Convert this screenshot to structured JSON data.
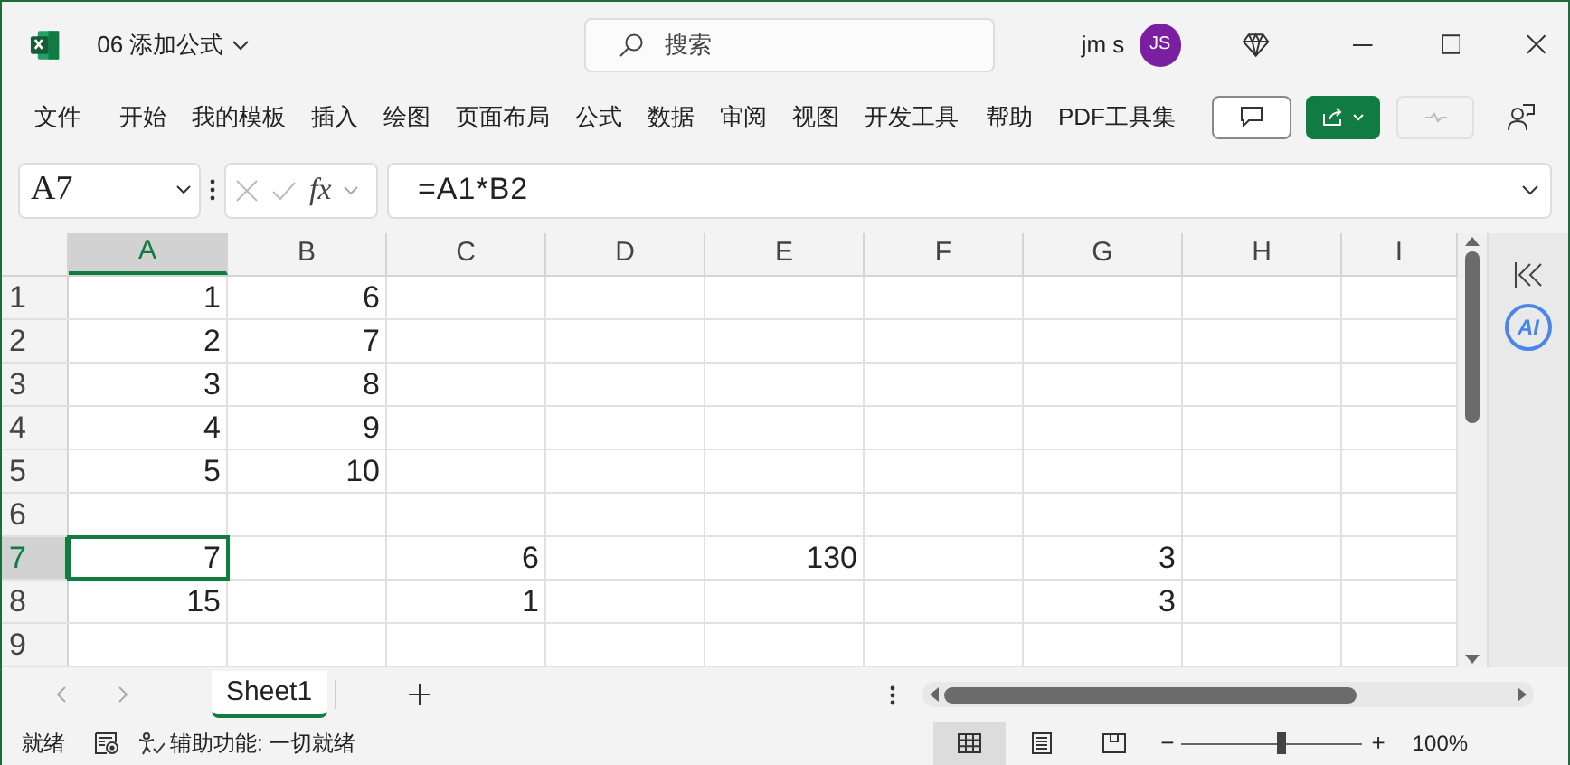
{
  "title_bar": {
    "file_name": "06 添加公式",
    "search_placeholder": "搜索",
    "user_name": "jm s",
    "avatar_initials": "JS"
  },
  "menu": [
    {
      "label": "文件"
    },
    {
      "label": "开始"
    },
    {
      "label": "我的模板"
    },
    {
      "label": "插入"
    },
    {
      "label": "绘图"
    },
    {
      "label": "页面布局"
    },
    {
      "label": "公式"
    },
    {
      "label": "数据"
    },
    {
      "label": "审阅"
    },
    {
      "label": "视图"
    },
    {
      "label": "开发工具"
    },
    {
      "label": "帮助"
    },
    {
      "label": "PDF工具集"
    }
  ],
  "formula_bar": {
    "name_box": "A7",
    "fx": "fx",
    "formula": "=A1*B2"
  },
  "columns": [
    {
      "label": "A",
      "selected": true
    },
    {
      "label": "B",
      "selected": false
    },
    {
      "label": "C",
      "selected": false
    },
    {
      "label": "D",
      "selected": false
    },
    {
      "label": "E",
      "selected": false
    },
    {
      "label": "F",
      "selected": false
    },
    {
      "label": "G",
      "selected": false
    },
    {
      "label": "H",
      "selected": false
    },
    {
      "label": "I",
      "selected": false
    }
  ],
  "rows": [
    {
      "label": "1",
      "selected": false,
      "cells": [
        {
          "kind": "value",
          "value": "1",
          "selected": false
        },
        {
          "kind": "value",
          "value": "6",
          "selected": false
        },
        {
          "kind": "empty"
        },
        {
          "kind": "empty"
        },
        {
          "kind": "empty"
        },
        {
          "kind": "empty"
        },
        {
          "kind": "empty"
        },
        {
          "kind": "empty"
        },
        {
          "kind": "empty"
        }
      ]
    },
    {
      "label": "2",
      "selected": false,
      "cells": [
        {
          "kind": "value",
          "value": "2",
          "selected": false
        },
        {
          "kind": "value",
          "value": "7",
          "selected": false
        },
        {
          "kind": "empty"
        },
        {
          "kind": "empty"
        },
        {
          "kind": "empty"
        },
        {
          "kind": "empty"
        },
        {
          "kind": "empty"
        },
        {
          "kind": "empty"
        },
        {
          "kind": "empty"
        }
      ]
    },
    {
      "label": "3",
      "selected": false,
      "cells": [
        {
          "kind": "value",
          "value": "3",
          "selected": false
        },
        {
          "kind": "value",
          "value": "8",
          "selected": false
        },
        {
          "kind": "empty"
        },
        {
          "kind": "empty"
        },
        {
          "kind": "empty"
        },
        {
          "kind": "empty"
        },
        {
          "kind": "empty"
        },
        {
          "kind": "empty"
        },
        {
          "kind": "empty"
        }
      ]
    },
    {
      "label": "4",
      "selected": false,
      "cells": [
        {
          "kind": "value",
          "value": "4",
          "selected": false
        },
        {
          "kind": "value",
          "value": "9",
          "selected": false
        },
        {
          "kind": "empty"
        },
        {
          "kind": "empty"
        },
        {
          "kind": "empty"
        },
        {
          "kind": "empty"
        },
        {
          "kind": "empty"
        },
        {
          "kind": "empty"
        },
        {
          "kind": "empty"
        }
      ]
    },
    {
      "label": "5",
      "selected": false,
      "cells": [
        {
          "kind": "value",
          "value": "5",
          "selected": false
        },
        {
          "kind": "value",
          "value": "10",
          "selected": false
        },
        {
          "kind": "empty"
        },
        {
          "kind": "empty"
        },
        {
          "kind": "empty"
        },
        {
          "kind": "empty"
        },
        {
          "kind": "empty"
        },
        {
          "kind": "empty"
        },
        {
          "kind": "empty"
        }
      ]
    },
    {
      "label": "6",
      "selected": false,
      "cells": [
        {
          "kind": "empty"
        },
        {
          "kind": "empty"
        },
        {
          "kind": "empty"
        },
        {
          "kind": "empty"
        },
        {
          "kind": "empty"
        },
        {
          "kind": "empty"
        },
        {
          "kind": "empty"
        },
        {
          "kind": "empty"
        },
        {
          "kind": "empty"
        }
      ]
    },
    {
      "label": "7",
      "selected": true,
      "cells": [
        {
          "kind": "value",
          "value": "7",
          "selected": true
        },
        {
          "kind": "empty"
        },
        {
          "kind": "value",
          "value": "6",
          "selected": false
        },
        {
          "kind": "empty"
        },
        {
          "kind": "value",
          "value": "130",
          "selected": false
        },
        {
          "kind": "empty"
        },
        {
          "kind": "value",
          "value": "3",
          "selected": false
        },
        {
          "kind": "empty"
        },
        {
          "kind": "empty"
        }
      ]
    },
    {
      "label": "8",
      "selected": false,
      "cells": [
        {
          "kind": "value",
          "value": "15",
          "selected": false
        },
        {
          "kind": "empty"
        },
        {
          "kind": "value",
          "value": "1",
          "selected": false
        },
        {
          "kind": "empty"
        },
        {
          "kind": "empty"
        },
        {
          "kind": "empty"
        },
        {
          "kind": "value",
          "value": "3",
          "selected": false
        },
        {
          "kind": "empty"
        },
        {
          "kind": "empty"
        }
      ]
    },
    {
      "label": "9",
      "selected": false,
      "cells": [
        {
          "kind": "empty"
        },
        {
          "kind": "empty"
        },
        {
          "kind": "empty"
        },
        {
          "kind": "empty"
        },
        {
          "kind": "empty"
        },
        {
          "kind": "empty"
        },
        {
          "kind": "empty"
        },
        {
          "kind": "empty"
        },
        {
          "kind": "empty"
        }
      ]
    }
  ],
  "side_panel": {
    "ai_label": "AI"
  },
  "sheet_tabs": [
    {
      "label": "Sheet1",
      "selected": true
    }
  ],
  "status_bar": {
    "ready": "就绪",
    "accessibility": "辅助功能: 一切就绪",
    "zoom_plus": "+",
    "zoom_minus": "−",
    "zoom": "100%",
    "views": [
      {
        "kind": "normal",
        "selected": true
      },
      {
        "kind": "page_layout",
        "selected": false
      },
      {
        "kind": "page_break",
        "selected": false
      }
    ],
    "zoom_slider": {
      "level": 0.55
    }
  }
}
